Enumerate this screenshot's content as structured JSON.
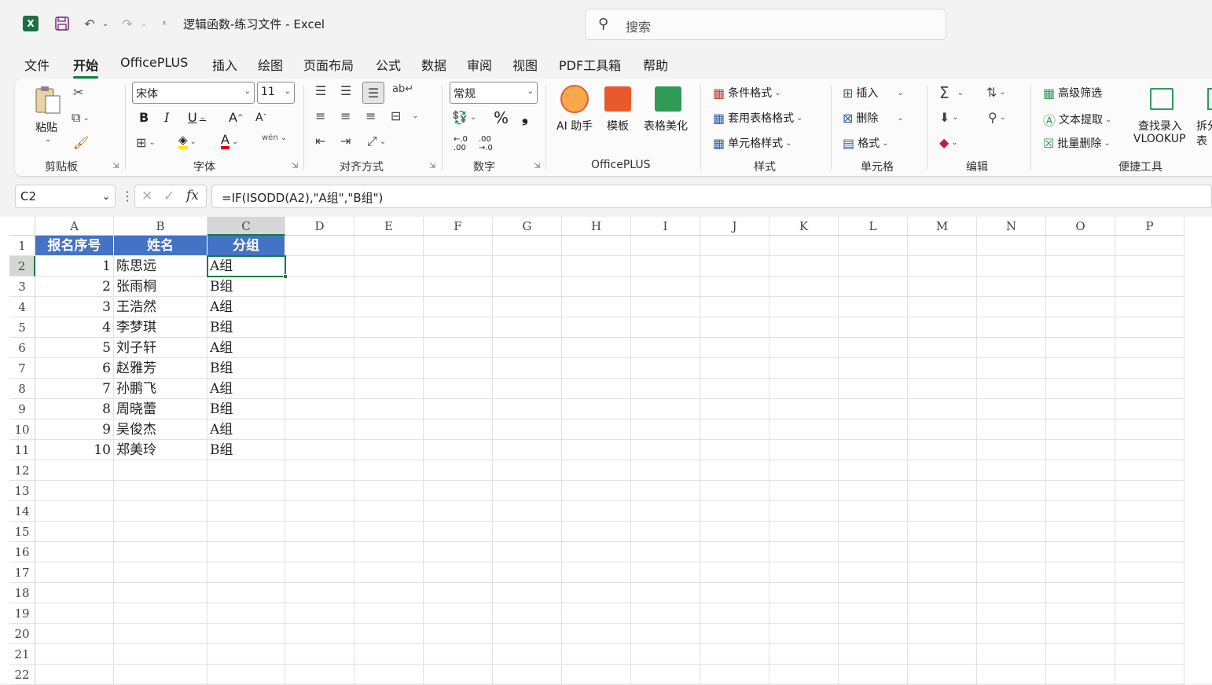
{
  "app": {
    "title": "逻辑函数-练习文件 - Excel",
    "logo": "X",
    "search_placeholder": "搜索"
  },
  "menu": [
    "文件",
    "开始",
    "OfficePLUS",
    "插入",
    "绘图",
    "页面布局",
    "公式",
    "数据",
    "审阅",
    "视图",
    "PDF工具箱",
    "帮助"
  ],
  "ribbon": {
    "clipboard": {
      "label": "剪贴板",
      "paste": "粘贴"
    },
    "font": {
      "label": "字体",
      "font_name": "宋体",
      "font_size": "11"
    },
    "alignment": {
      "label": "对齐方式"
    },
    "number": {
      "label": "数字",
      "format": "常规"
    },
    "officeplus": {
      "label": "OfficePLUS",
      "ai": "AI 助手",
      "template": "模板",
      "beautify": "表格美化"
    },
    "styles": {
      "label": "样式",
      "conditional": "条件格式",
      "table_format": "套用表格格式",
      "cell_style": "单元格样式"
    },
    "cells": {
      "label": "单元格",
      "insert": "插入",
      "delete": "删除",
      "format": "格式"
    },
    "editing": {
      "label": "编辑"
    },
    "tools": {
      "label": "便捷工具",
      "advanced_filter": "高级筛选",
      "text_extract": "文本提取",
      "batch_delete": "批量删除",
      "lookup_line1": "查找录入",
      "lookup_line2": "VLOOKUP",
      "split_line1": "拆分",
      "split_line2": "表"
    }
  },
  "formula_bar": {
    "name_box": "C2",
    "formula": "=IF(ISODD(A2),\"A组\",\"B组\")",
    "fx": "fx"
  },
  "sheet": {
    "columns": [
      "A",
      "B",
      "C",
      "D",
      "E",
      "F",
      "G",
      "H",
      "I",
      "J",
      "K",
      "L",
      "M",
      "N",
      "O",
      "P"
    ],
    "rows": [
      "1",
      "2",
      "3",
      "4",
      "5",
      "6",
      "7",
      "8",
      "9",
      "10",
      "11",
      "12",
      "13",
      "14",
      "15",
      "16",
      "17",
      "18",
      "19",
      "20",
      "21",
      "22"
    ],
    "header": [
      "报名序号",
      "姓名",
      "分组"
    ],
    "data": [
      [
        "1",
        "陈思远",
        "A组"
      ],
      [
        "2",
        "张雨桐",
        "B组"
      ],
      [
        "3",
        "王浩然",
        "A组"
      ],
      [
        "4",
        "李梦琪",
        "B组"
      ],
      [
        "5",
        "刘子轩",
        "A组"
      ],
      [
        "6",
        "赵雅芳",
        "B组"
      ],
      [
        "7",
        "孙鹏飞",
        "A组"
      ],
      [
        "8",
        "周晓蕾",
        "B组"
      ],
      [
        "9",
        "吴俊杰",
        "A组"
      ],
      [
        "10",
        "郑美玲",
        "B组"
      ]
    ],
    "selected_cell": "C2",
    "header_fill": "#4472c4",
    "accent": "#117e3f"
  }
}
